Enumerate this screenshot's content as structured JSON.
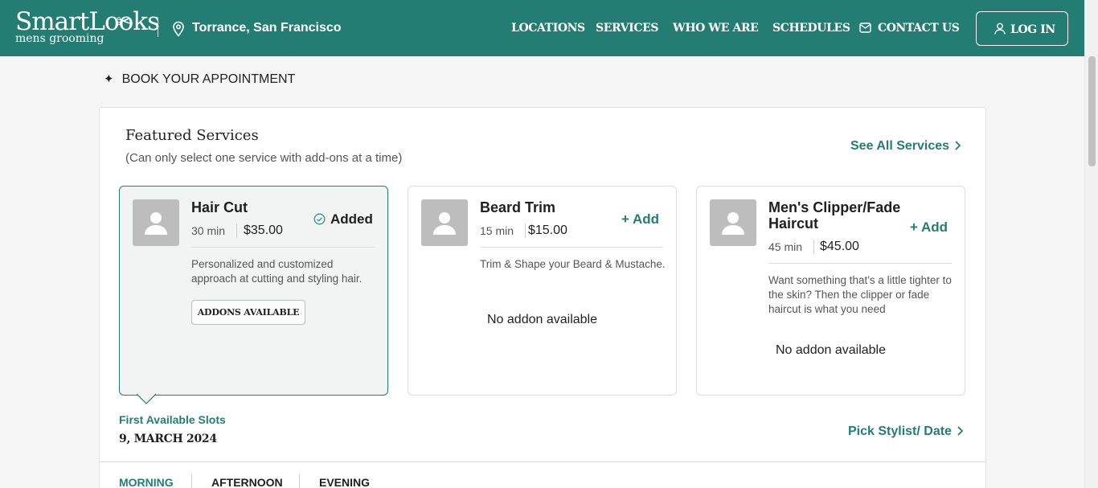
{
  "brand": {
    "name_line1": "SmartLooks",
    "name_line2": "mens grooming"
  },
  "location": {
    "label": "Torrance, San Francisco"
  },
  "nav": {
    "locations": "LOCATIONS",
    "services": "SERVICES",
    "who_we_are": "WHO WE ARE",
    "schedules": "SCHEDULES",
    "contact": "CONTACT US",
    "login": "LOG IN"
  },
  "page": {
    "heading": "BOOK YOUR APPOINTMENT"
  },
  "featured": {
    "title": "Featured Services",
    "subtitle": "(Can only select one service with add-ons at a time)",
    "see_all": "See All Services"
  },
  "services": [
    {
      "name": "Hair Cut",
      "duration": "30 min",
      "price": "$35.00",
      "description": "Personalized and customized approach at cutting and styling hair.",
      "status": "Added",
      "addons": "ADDONS AVAILABLE",
      "selected": true
    },
    {
      "name": "Beard Trim",
      "duration": "15 min",
      "price": "$15.00",
      "description": "Trim & Shape your Beard & Mustache.",
      "action": "+ Add",
      "addons": "No addon available",
      "selected": false
    },
    {
      "name": "Men's Clipper/Fade Haircut",
      "duration": "45 min",
      "price": "$45.00",
      "description": "Want something that's a little tighter to the skin? Then the clipper or fade haircut is what you need",
      "action": "+ Add",
      "addons": "No addon available",
      "selected": false
    }
  ],
  "slots": {
    "label": "First Available Slots",
    "date": "9, MARCH 2024",
    "pick_stylist": "Pick Stylist/ Date",
    "tabs": [
      "MORNING",
      "AFTERNOON",
      "EVENING"
    ],
    "active_tab": "MORNING"
  },
  "colors": {
    "primary": "#247d72",
    "background": "#f5f5f5",
    "card_selected_bg": "#f2f4f3"
  },
  "icons": [
    "location-pin-icon",
    "mail-icon",
    "user-icon",
    "sparkle-icon",
    "chevron-right-icon",
    "check-circle-icon",
    "avatar-placeholder-icon"
  ]
}
